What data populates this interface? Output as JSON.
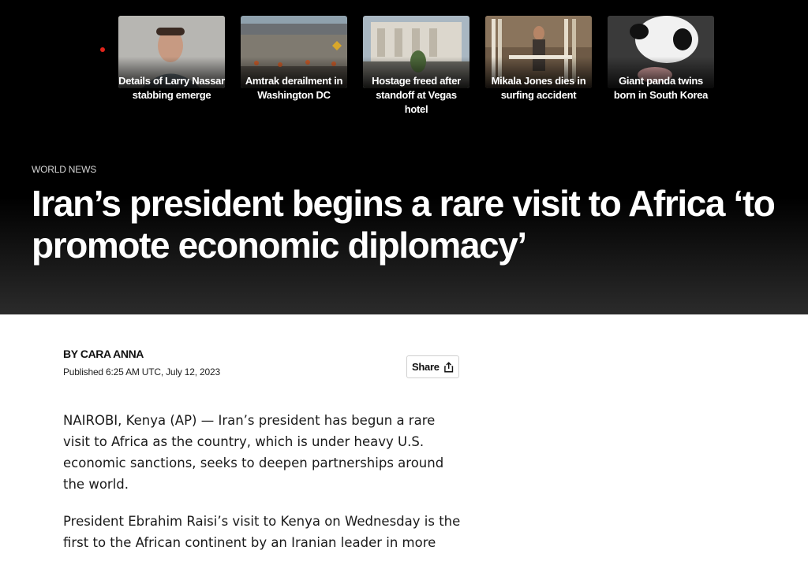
{
  "top_stories": [
    {
      "label": "Details of Larry Nassar stabbing emerge"
    },
    {
      "label": "Amtrak derailment in Washington DC"
    },
    {
      "label": "Hostage freed after standoff at Vegas hotel"
    },
    {
      "label": "Mikala Jones dies in surfing accident"
    },
    {
      "label": "Giant panda twins born in South Korea"
    }
  ],
  "article": {
    "section": "WORLD NEWS",
    "headline": "Iran’s president begins a rare visit to Africa ‘to promote economic diplomacy’",
    "byline": "BY CARA ANNA",
    "published": "Published 6:25 AM UTC, July 12, 2023",
    "share_label": "Share",
    "paragraphs": [
      "NAIROBI, Kenya (AP) — Iran’s president has begun a rare visit to Africa as the country, which is under heavy U.S. economic sanctions, seeks to deepen partnerships around the world.",
      "President Ebrahim Raisi’s visit to Kenya on Wednesday is the first to the African continent by an Iranian leader in more"
    ]
  },
  "colors": {
    "live_dot": "#e0241b",
    "hero_background": "#000000",
    "headline_text": "#ffffff"
  },
  "icons": {
    "live": "live-indicator-dot",
    "share": "share-icon"
  }
}
